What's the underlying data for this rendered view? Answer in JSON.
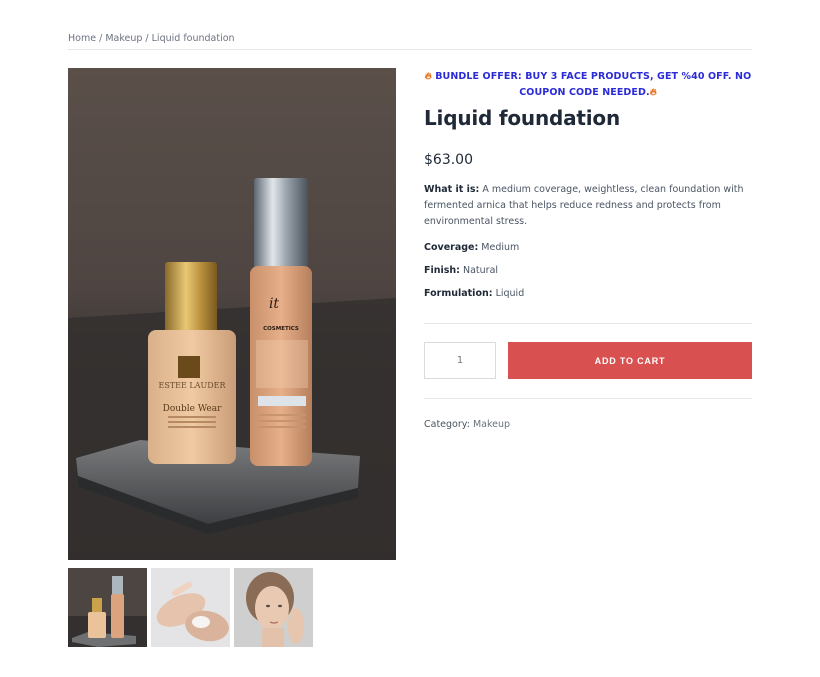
{
  "breadcrumb": {
    "home": "Home",
    "sep1": " / ",
    "category": "Makeup",
    "sep2": " / ",
    "current": "Liquid foundation"
  },
  "offer": {
    "text": "BUNDLE OFFER: BUY 3 FACE PRODUCTS, GET %40 OFF. NO COUPON CODE NEEDED."
  },
  "product": {
    "title": "Liquid foundation",
    "price": "$63.00",
    "what_label": "What it is:",
    "what_text": " A medium coverage, weightless, clean foundation with fermented arnica that helps reduce redness and protects from environmental stress.",
    "coverage_label": "Coverage:",
    "coverage_value": " Medium",
    "finish_label": "Finish:",
    "finish_value": " Natural",
    "formulation_label": "Formulation:",
    "formulation_value": " Liquid"
  },
  "cart": {
    "quantity": "1",
    "button": "ADD TO CART"
  },
  "meta": {
    "category_label": "Category: ",
    "category_value": "Makeup"
  },
  "images": {
    "main": {
      "label_lauder": "ESTEE LAUDER",
      "label_dw": "Double Wear",
      "label_it": "it",
      "label_cosmetics": "COSMETICS"
    },
    "thumbs": [
      "foundation-bottles",
      "hands-applying-cream",
      "woman-face"
    ]
  },
  "colors": {
    "accent": "#d95050",
    "offer": "#2b2bd8",
    "title": "#1f2937"
  }
}
